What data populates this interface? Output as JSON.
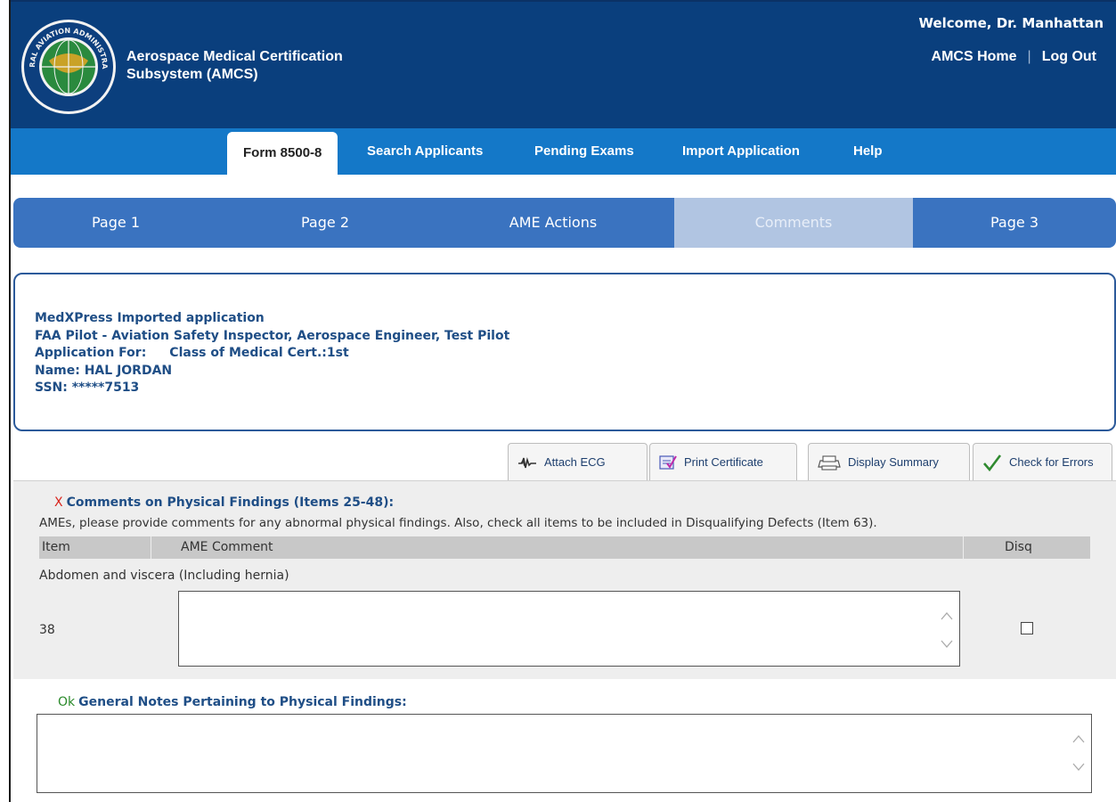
{
  "header": {
    "app_title_line1": "Aerospace Medical Certification",
    "app_title_line2": "Subsystem (AMCS)",
    "welcome": "Welcome, Dr. Manhattan",
    "home_link": "AMCS Home",
    "separator": "|",
    "logout_link": "Log Out",
    "logo_text": "FEDERAL AVIATION ADMINISTRATION"
  },
  "main_tabs": [
    {
      "label": "Form 8500-8",
      "active": true
    },
    {
      "label": "Search Applicants",
      "active": false
    },
    {
      "label": "Pending Exams",
      "active": false
    },
    {
      "label": "Import Application",
      "active": false
    },
    {
      "label": "Help",
      "active": false
    }
  ],
  "page_tabs": [
    {
      "label": "Page 1",
      "active": false
    },
    {
      "label": "Page 2",
      "active": false
    },
    {
      "label": "AME Actions",
      "active": false
    },
    {
      "label": "Comments",
      "active": true
    },
    {
      "label": "Page 3",
      "active": false
    }
  ],
  "applicant": {
    "source": "MedXPress Imported application",
    "occupation": "FAA Pilot - Aviation Safety Inspector, Aerospace Engineer, Test Pilot",
    "application_for_label": "Application For:",
    "class_label": "Class of Medical Cert.:1st",
    "name": "Name: HAL JORDAN",
    "ssn": "SSN: *****7513"
  },
  "actions": [
    {
      "label": "Attach ECG",
      "icon": "ecg-icon"
    },
    {
      "label": "Print Certificate",
      "icon": "print-certificate-icon"
    },
    {
      "label": "Display Summary",
      "icon": "printer-icon"
    },
    {
      "label": "Check for Errors",
      "icon": "checkmark-icon"
    }
  ],
  "physical_findings": {
    "status_mark": "X",
    "heading": "Comments on Physical Findings (Items 25-48):",
    "instructions": "AMEs, please provide comments for any abnormal physical findings. Also, check all items to be included in Disqualifying Defects (Item 63).",
    "columns": {
      "item": "Item",
      "comment": "AME Comment",
      "disq": "Disq"
    },
    "rows": [
      {
        "label": "Abdomen and viscera (Including hernia)",
        "item": "38",
        "comment": "",
        "disq": false
      }
    ]
  },
  "general_notes": {
    "status_mark": "Ok",
    "heading": "General Notes Pertaining to Physical Findings:",
    "value": ""
  },
  "colors": {
    "header_bg": "#0a3f7d",
    "tabbar_bg": "#1478c8",
    "pagenav_bg": "#3a73c0",
    "pagenav_active": "#b1c5e2",
    "heading_text": "#1f4e86",
    "error_mark": "#d9241c",
    "ok_mark": "#2a8a2a"
  }
}
